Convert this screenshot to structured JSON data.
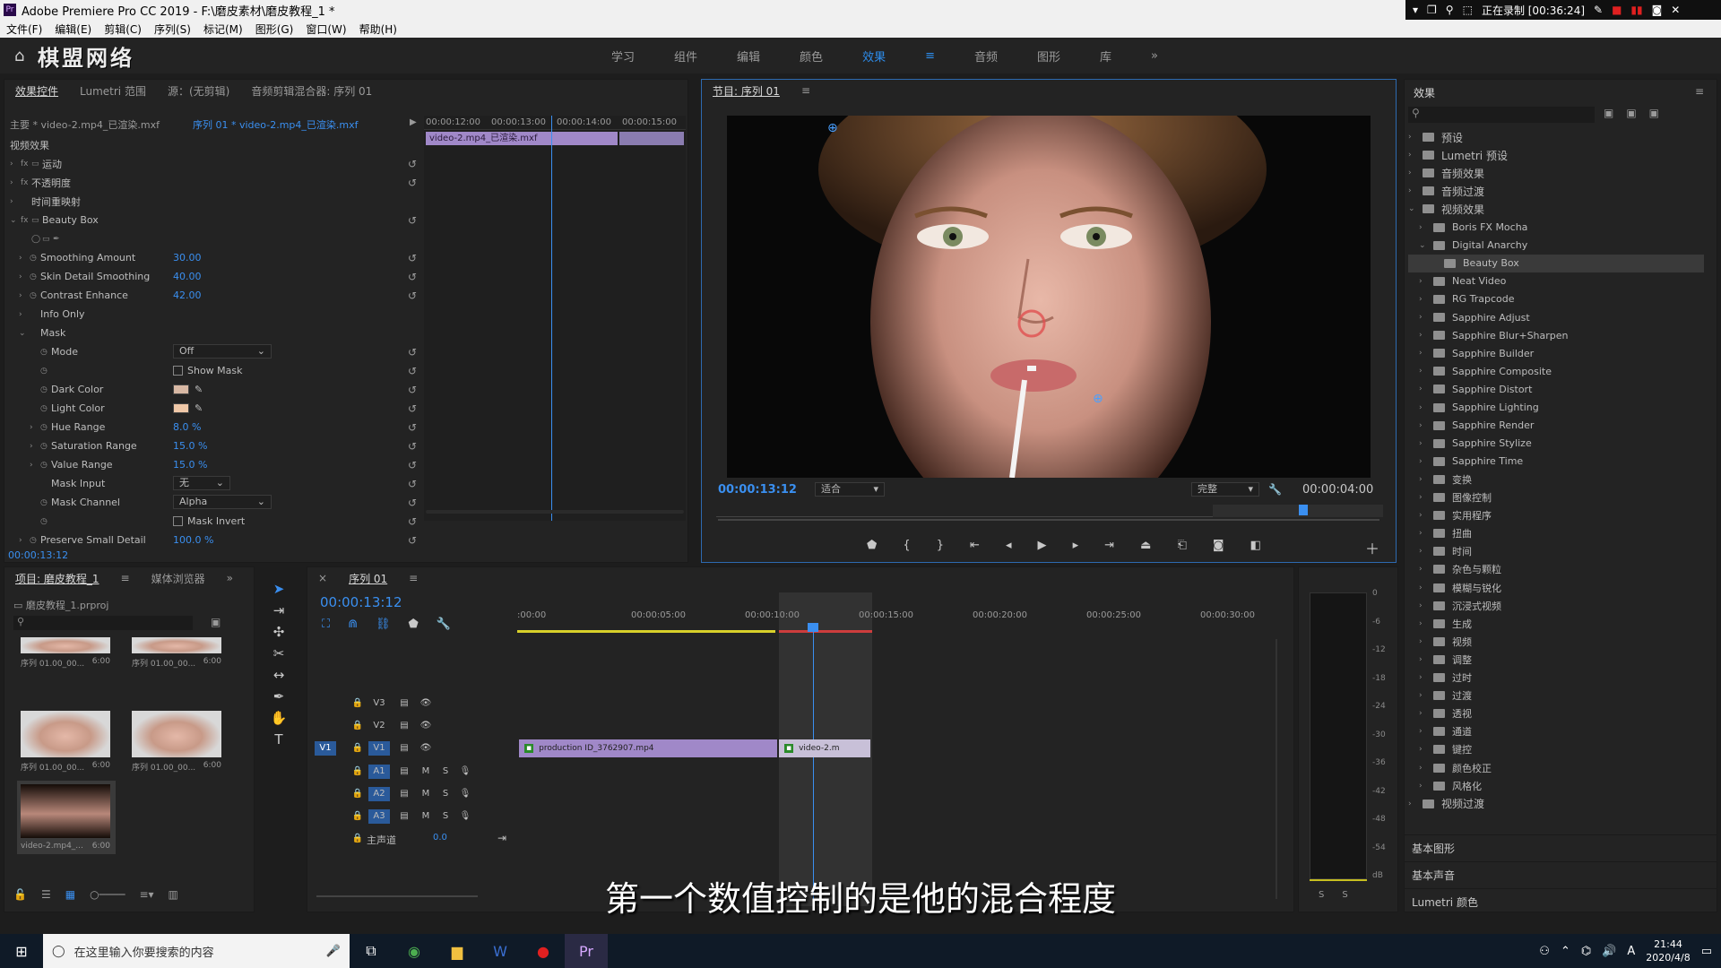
{
  "window": {
    "title": "Adobe Premiere Pro CC 2019 - F:\\磨皮素材\\磨皮教程_1 *"
  },
  "recorder": {
    "status": "正在录制 [00:36:24]"
  },
  "menu": [
    "文件(F)",
    "编辑(E)",
    "剪辑(C)",
    "序列(S)",
    "标记(M)",
    "图形(G)",
    "窗口(W)",
    "帮助(H)"
  ],
  "watermark": "棋盟网络",
  "workspaces": [
    "学习",
    "组件",
    "编辑",
    "颜色",
    "效果",
    "音频",
    "图形",
    "库"
  ],
  "workspace_more": "»",
  "effect_controls": {
    "tabs": [
      "效果控件",
      "Lumetri 范围",
      "源：(无剪辑)",
      "音频剪辑混合器: 序列 01"
    ],
    "master": "主要 * video-2.mp4_已渲染.mxf",
    "sequence": "序列 01 * video-2.mp4_已渲染.mxf",
    "ruler": [
      "00:00:12:00",
      "00:00:13:00",
      "00:00:14:00",
      "00:00:15:00"
    ],
    "clip_label": "video-2.mp4_已渲染.mxf",
    "video_effects": "视频效果",
    "motion": "运动",
    "opacity": "不透明度",
    "time_remap": "时间重映射",
    "beauty_box": "Beauty Box",
    "params": [
      {
        "name": "Smoothing Amount",
        "value": "30.00"
      },
      {
        "name": "Skin Detail Smoothing",
        "value": "40.00"
      },
      {
        "name": "Contrast Enhance",
        "value": "42.00"
      }
    ],
    "info_only": "Info Only",
    "mask": "Mask",
    "mode_label": "Mode",
    "mode_value": "Off",
    "show_mask": "Show Mask",
    "dark_color": "Dark Color",
    "dark_color_hex": "#d8b8a4",
    "light_color": "Light Color",
    "light_color_hex": "#f0c8a8",
    "hue_range": "Hue Range",
    "hue_value": "8.0 %",
    "sat_range": "Saturation Range",
    "sat_value": "15.0 %",
    "val_range": "Value Range",
    "val_value": "15.0 %",
    "mask_input": "Mask Input",
    "mask_input_value": "无",
    "mask_channel": "Mask Channel",
    "mask_channel_value": "Alpha",
    "mask_invert": "Mask Invert",
    "preserve": "Preserve Small Detail",
    "preserve_value": "100.0 %",
    "timecode": "00:00:13:12"
  },
  "program": {
    "tab": "节目: 序列 01",
    "timecode": "00:00:13:12",
    "fit": "适合",
    "quality": "完整",
    "duration": "00:00:04:00"
  },
  "effects_panel": {
    "title": "效果",
    "items": [
      {
        "label": "预设",
        "level": 0,
        "open": false
      },
      {
        "label": "Lumetri 预设",
        "level": 0,
        "open": false
      },
      {
        "label": "音频效果",
        "level": 0,
        "open": false
      },
      {
        "label": "音频过渡",
        "level": 0,
        "open": false
      },
      {
        "label": "视频效果",
        "level": 0,
        "open": true
      },
      {
        "label": "Boris FX Mocha",
        "level": 1,
        "open": false
      },
      {
        "label": "Digital Anarchy",
        "level": 1,
        "open": true
      },
      {
        "label": "Beauty Box",
        "level": 2,
        "open": false
      },
      {
        "label": "Neat Video",
        "level": 1,
        "open": false
      },
      {
        "label": "RG Trapcode",
        "level": 1,
        "open": false
      },
      {
        "label": "Sapphire Adjust",
        "level": 1,
        "open": false
      },
      {
        "label": "Sapphire Blur+Sharpen",
        "level": 1,
        "open": false
      },
      {
        "label": "Sapphire Builder",
        "level": 1,
        "open": false
      },
      {
        "label": "Sapphire Composite",
        "level": 1,
        "open": false
      },
      {
        "label": "Sapphire Distort",
        "level": 1,
        "open": false
      },
      {
        "label": "Sapphire Lighting",
        "level": 1,
        "open": false
      },
      {
        "label": "Sapphire Render",
        "level": 1,
        "open": false
      },
      {
        "label": "Sapphire Stylize",
        "level": 1,
        "open": false
      },
      {
        "label": "Sapphire Time",
        "level": 1,
        "open": false
      },
      {
        "label": "变换",
        "level": 1,
        "open": false
      },
      {
        "label": "图像控制",
        "level": 1,
        "open": false
      },
      {
        "label": "实用程序",
        "level": 1,
        "open": false
      },
      {
        "label": "扭曲",
        "level": 1,
        "open": false
      },
      {
        "label": "时间",
        "level": 1,
        "open": false
      },
      {
        "label": "杂色与颗粒",
        "level": 1,
        "open": false
      },
      {
        "label": "模糊与锐化",
        "level": 1,
        "open": false
      },
      {
        "label": "沉浸式视频",
        "level": 1,
        "open": false
      },
      {
        "label": "生成",
        "level": 1,
        "open": false
      },
      {
        "label": "视频",
        "level": 1,
        "open": false
      },
      {
        "label": "调整",
        "level": 1,
        "open": false
      },
      {
        "label": "过时",
        "level": 1,
        "open": false
      },
      {
        "label": "过渡",
        "level": 1,
        "open": false
      },
      {
        "label": "透视",
        "level": 1,
        "open": false
      },
      {
        "label": "通道",
        "level": 1,
        "open": false
      },
      {
        "label": "键控",
        "level": 1,
        "open": false
      },
      {
        "label": "颜色校正",
        "level": 1,
        "open": false
      },
      {
        "label": "风格化",
        "level": 1,
        "open": false
      },
      {
        "label": "视频过渡",
        "level": 0,
        "open": false
      }
    ],
    "bottom": [
      "基本图形",
      "基本声音",
      "Lumetri 颜色"
    ]
  },
  "project": {
    "tabs": [
      "项目: 磨皮教程_1",
      "媒体浏览器"
    ],
    "file": "磨皮教程_1.prproj",
    "thumbs": [
      {
        "label": "序列 01.00_00...",
        "dur": "6:00"
      },
      {
        "label": "序列 01.00_00...",
        "dur": "6:00"
      },
      {
        "label": "序列 01.00_00...",
        "dur": "6:00"
      },
      {
        "label": "序列 01.00_00...",
        "dur": "6:00"
      },
      {
        "label": "video-2.mp4_...",
        "dur": "6:00"
      }
    ]
  },
  "timeline": {
    "tab": "序列 01",
    "timecode": "00:00:13:12",
    "ruler": [
      ":00:00",
      "00:00:05:00",
      "00:00:10:00",
      "00:00:15:00",
      "00:00:20:00",
      "00:00:25:00",
      "00:00:30:00"
    ],
    "video_tracks": [
      "V3",
      "V2",
      "V1"
    ],
    "audio_tracks": [
      "A1",
      "A2",
      "A3"
    ],
    "source_v": "V1",
    "master": "主声道",
    "master_val": "0.0",
    "clip1": "production ID_3762907.mp4",
    "clip2": "video-2.m",
    "meter": [
      "0",
      "-6",
      "-12",
      "-18",
      "-24",
      "-30",
      "-36",
      "-42",
      "-48",
      "-54",
      "dB"
    ]
  },
  "subtitle": "第一个数值控制的是他的混合程度",
  "taskbar": {
    "search": "在这里输入你要搜索的内容",
    "time": "21:44",
    "date": "2020/4/8"
  }
}
